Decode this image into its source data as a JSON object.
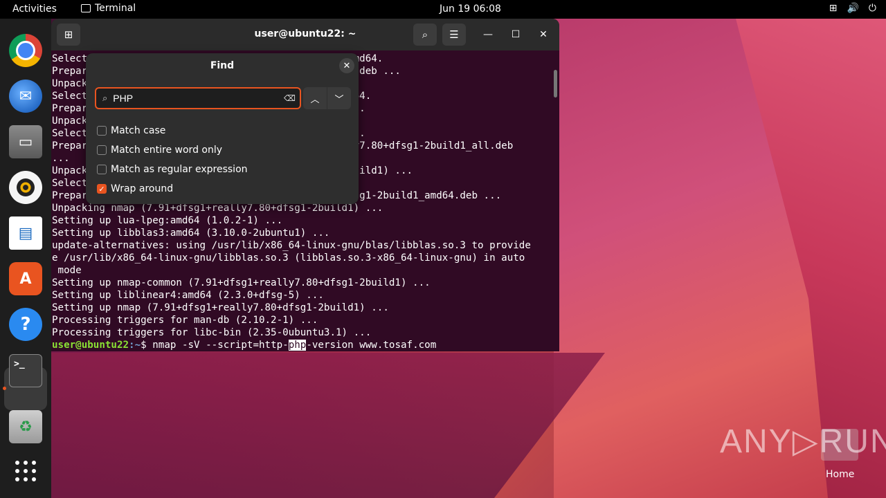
{
  "topbar": {
    "activities": "Activities",
    "app_name": "Terminal",
    "clock": "Jun 19  06:08",
    "tray": {
      "network_icon": "⊞",
      "volume_icon": "🔊",
      "power_icon": "⏻"
    }
  },
  "dock": {
    "items": [
      "chrome",
      "thunderbird",
      "files",
      "rhythmbox",
      "libreoffice-writer",
      "app-center",
      "help",
      "terminal",
      "trash",
      "show-apps"
    ],
    "terminal_glyph": ">_"
  },
  "terminal": {
    "title": "user@ubuntu22: ~",
    "lines": [
      "Select                                          4:amd64.",
      "Prepar                                         md64.deb ...",
      "Unpack",
      "Select                                          amd64.",
      "Prepar                                          o ...",
      "Unpack",
      "Select                                          tion.",
      "Prepar                                         eally7.80+dfsg1-2build1_all.deb",
      "...",
      "Unpack                                         l-2build1) ...",
      "Select",
      "Prepar                                         0+dfsg1-2build1_amd64.deb ...",
      "Unpacking nmap (7.91+dfsg1+really7.80+dfsg1-2build1) ...",
      "Setting up lua-lpeg:amd64 (1.0.2-1) ...",
      "Setting up libblas3:amd64 (3.10.0-2ubuntu1) ...",
      "update-alternatives: using /usr/lib/x86_64-linux-gnu/blas/libblas.so.3 to provide",
      "e /usr/lib/x86_64-linux-gnu/libblas.so.3 (libblas.so.3-x86_64-linux-gnu) in auto",
      " mode",
      "Setting up nmap-common (7.91+dfsg1+really7.80+dfsg1-2build1) ...",
      "Setting up liblinear4:amd64 (2.3.0+dfsg-5) ...",
      "Setting up nmap (7.91+dfsg1+really7.80+dfsg1-2build1) ...",
      "Processing triggers for man-db (2.10.2-1) ...",
      "Processing triggers for libc-bin (2.35-0ubuntu3.1) ..."
    ],
    "prompt_user": "user@ubuntu22",
    "prompt_path": ":~",
    "prompt_sym": "$ ",
    "command_pre": "nmap -sV --script=http-",
    "command_match": "php",
    "command_post": "-version www.tosaf.com"
  },
  "find": {
    "title": "Find",
    "query": "PHP",
    "options": [
      {
        "label": "Match case",
        "checked": false
      },
      {
        "label": "Match entire word only",
        "checked": false
      },
      {
        "label": "Match as regular expression",
        "checked": false
      },
      {
        "label": "Wrap around",
        "checked": true
      }
    ]
  },
  "watermark": {
    "text": "ANY▷RUN",
    "home_label": "Home"
  },
  "colors": {
    "accent": "#e95420",
    "terminal_bg": "#300a24",
    "prompt_user": "#8ae234",
    "prompt_path": "#729fcf"
  }
}
